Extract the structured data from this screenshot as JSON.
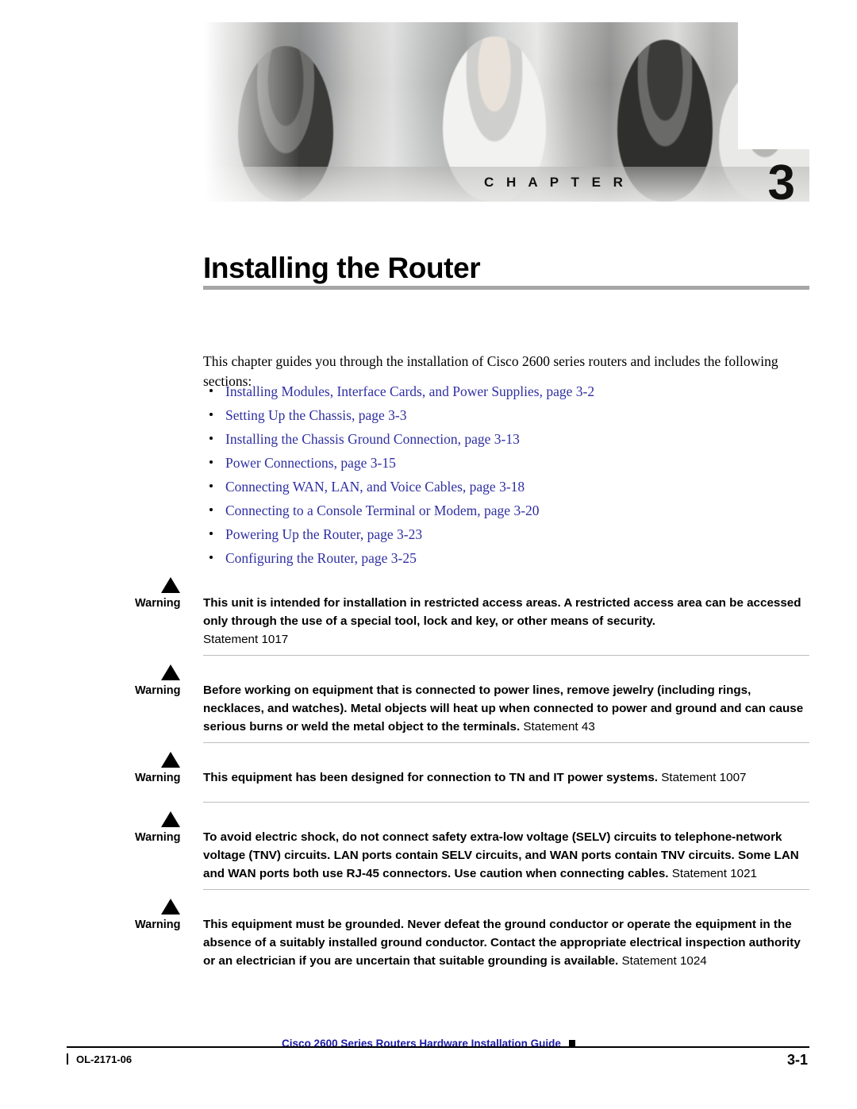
{
  "banner": {
    "chapter_word": "C H A P T E R",
    "chapter_number": "3"
  },
  "title": "Installing the Router",
  "intro": "This chapter guides you through the installation of Cisco 2600 series routers and includes the following sections:",
  "links": [
    "Installing Modules, Interface Cards, and Power Supplies, page 3-2",
    "Setting Up the Chassis, page 3-3",
    "Installing the Chassis Ground Connection, page 3-13",
    "Power Connections, page 3-15",
    "Connecting WAN, LAN, and Voice Cables, page 3-18",
    "Connecting to a Console Terminal or Modem, page 3-20",
    "Powering Up the Router, page 3-23",
    "Configuring the Router, page 3-25"
  ],
  "warnings": [
    {
      "label": "Warning",
      "text": "This unit is intended for installation in restricted access areas. A restricted access area can be accessed only through the use of a special tool, lock and key, or other means of security.",
      "statement": "Statement 1017",
      "statement_on_new_line": true
    },
    {
      "label": "Warning",
      "text": "Before working on equipment that is connected to power lines, remove jewelry (including rings, necklaces, and watches). Metal objects will heat up when connected to power and ground and can cause serious burns or weld the metal object to the terminals.",
      "statement": "Statement 43",
      "statement_on_new_line": false
    },
    {
      "label": "Warning",
      "text": "This equipment has been designed for connection to TN and IT power systems.",
      "statement": "Statement 1007",
      "statement_on_new_line": false
    },
    {
      "label": "Warning",
      "text": "To avoid electric shock, do not connect safety extra-low voltage (SELV) circuits to telephone-network voltage (TNV) circuits. LAN ports contain SELV circuits, and WAN ports contain TNV circuits. Some LAN and WAN ports both use RJ-45 connectors. Use caution when connecting cables.",
      "statement": "Statement 1021",
      "statement_on_new_line": false
    },
    {
      "label": "Warning",
      "text": "This equipment must be grounded. Never defeat the ground conductor or operate the equipment in the absence of a suitably installed ground conductor. Contact the appropriate electrical inspection authority or an electrician if you are uncertain that suitable grounding is available.",
      "statement": "Statement 1024",
      "statement_on_new_line": false
    }
  ],
  "footer": {
    "doc_id": "OL-2171-06",
    "guide_title": "Cisco 2600 Series Routers Hardware Installation Guide",
    "page_number": "3-1"
  }
}
